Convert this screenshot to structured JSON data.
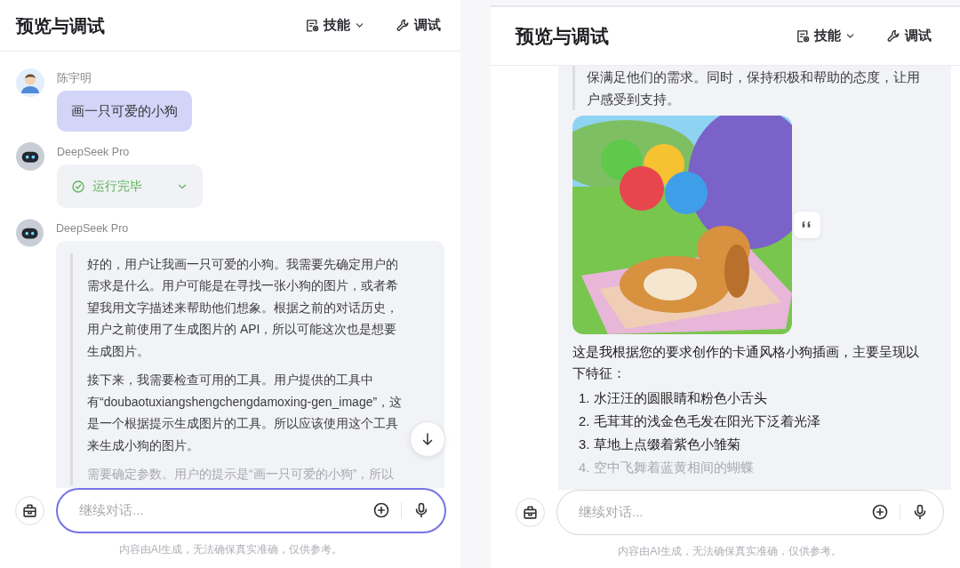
{
  "panels": [
    {
      "header": {
        "title": "预览与调试",
        "menus": [
          {
            "label": "技能",
            "kind": "dropdown"
          },
          {
            "label": "调试",
            "kind": "tool"
          }
        ]
      },
      "messages": [
        {
          "kind": "user",
          "sender": "陈宇明",
          "text": "画一只可爱的小狗"
        },
        {
          "kind": "status",
          "sender": "DeepSeek Pro",
          "text": "运行完毕",
          "expanded": false
        },
        {
          "kind": "reasoning",
          "sender": "DeepSeek Pro",
          "paragraphs": [
            {
              "text": "好的，用户让我画一只可爱的小狗。我需要先确定用户的需求是什么。用户可能是在寻找一张小狗的图片，或者希望我用文字描述来帮助他们想象。根据之前的对话历史，用户之前使用了生成图片的 API，所以可能这次也是想要生成图片。",
              "faded": false
            },
            {
              "text": "接下来，我需要检查可用的工具。用户提供的工具中有“doubaotuxiangshengchengdamoxing-gen_image”，这是一个根据提示生成图片的工具。所以应该使用这个工具来生成小狗的图片。",
              "faded": false
            },
            {
              "text": "需要确定参数。用户的提示是“画一只可爱的小狗”，所以",
              "faded": true
            }
          ]
        }
      ],
      "scroll_down": true,
      "input": {
        "placeholder": "继续对话...",
        "focused": true
      },
      "disclaimer": "内容由AI生成，无法确保真实准确，仅供参考。"
    },
    {
      "header": {
        "title": "预览与调试",
        "menus": [
          {
            "label": "技能",
            "kind": "dropdown"
          },
          {
            "label": "调试",
            "kind": "tool"
          }
        ]
      },
      "messages": [
        {
          "kind": "answer",
          "quote": [
            "保满足他们的需求。同时，保持积极和帮助的态度，让用",
            "户感受到支持。"
          ],
          "image": {
            "kind": "picture"
          },
          "text": "这是我根据您的要求创作的卡通风格小狗插画，主要呈现以下特征：",
          "items": [
            {
              "number": "1.",
              "text": "水汪汪的圆眼睛和粉色小舌头",
              "faded": false
            },
            {
              "number": "2.",
              "text": "毛茸茸的浅金色毛发在阳光下泛着光泽",
              "faded": false
            },
            {
              "number": "3.",
              "text": "草地上点缀着紫色小雏菊",
              "faded": false
            },
            {
              "number": "4.",
              "text": "空中飞舞着蓝黄相间的蝴蝶",
              "faded": true
            }
          ]
        }
      ],
      "input": {
        "placeholder": "继续对话...",
        "focused": false
      },
      "disclaimer": "内容由AI生成，无法确保真实准确，仅供参考。"
    }
  ]
}
